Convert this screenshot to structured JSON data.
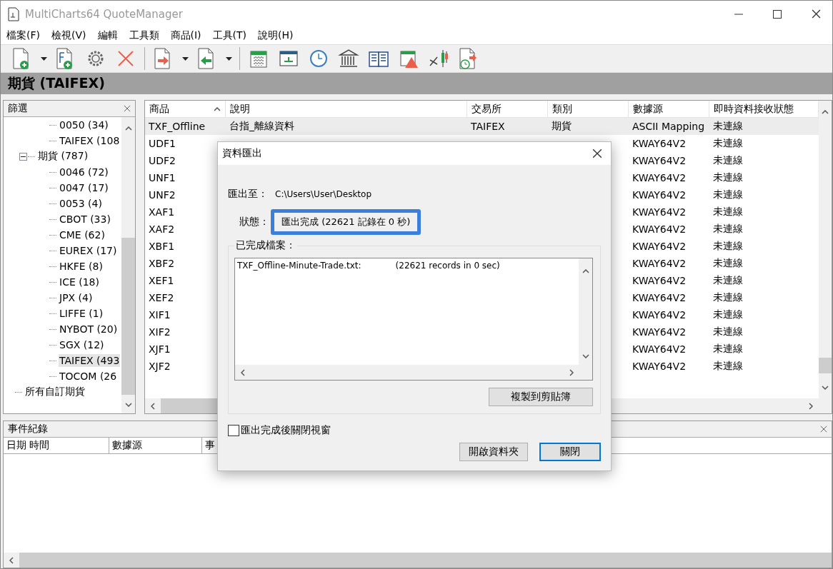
{
  "window": {
    "title": "MultiCharts64 QuoteManager"
  },
  "menu": [
    "檔案(F)",
    "檢視(V)",
    "編輯",
    "工具類",
    "商品(I)",
    "工具(T)",
    "說明(H)"
  ],
  "category_title": "期貨 (TAIFEX)",
  "filter_panel": {
    "title": "篩選",
    "tree": [
      {
        "children": [
          {
            "children": [
              {
                "label": "0050 (34)",
                "selected": false
              },
              {
                "label": "TAIFEX (108",
                "selected": false
              }
            ]
          },
          {
            "label": "期貨 (787)",
            "expanded": true,
            "selected": false,
            "children": [
              {
                "label": "0046 (72)",
                "selected": false
              },
              {
                "label": "0047 (17)",
                "selected": false
              },
              {
                "label": "0053 (4)",
                "selected": false
              },
              {
                "label": "CBOT (33)",
                "selected": false
              },
              {
                "label": "CME (62)",
                "selected": false
              },
              {
                "label": "EUREX (17)",
                "selected": false
              },
              {
                "label": "HKFE (8)",
                "selected": false
              },
              {
                "label": "ICE (18)",
                "selected": false
              },
              {
                "label": "JPX (4)",
                "selected": false
              },
              {
                "label": "LIFFE (1)",
                "selected": false
              },
              {
                "label": "NYBOT (20)",
                "selected": false
              },
              {
                "label": "SGX (12)",
                "selected": false
              },
              {
                "label": "TAIFEX (493",
                "selected": true
              },
              {
                "label": "TOCOM (26",
                "selected": false
              }
            ]
          }
        ]
      },
      {
        "label": "所有自訂期貨",
        "selected": false
      }
    ]
  },
  "symbols_table": {
    "columns": [
      {
        "label": "商品",
        "sorted": true
      },
      {
        "label": "說明",
        "sorted": false
      },
      {
        "label": "交易所",
        "sorted": false
      },
      {
        "label": "類別",
        "sorted": false
      },
      {
        "label": "數據源",
        "sorted": false
      },
      {
        "label": "即時資料接收狀態",
        "sorted": false
      }
    ],
    "rows": [
      {
        "symbol": "TXF_Offline",
        "description": "台指_離線資料",
        "exchange": "TAIFEX",
        "category": "期貨",
        "source": "ASCII Mapping",
        "status": "未連線",
        "selected": true
      },
      {
        "symbol": "UDF1",
        "source": "KWAY64V2",
        "status": "未連線",
        "selected": false
      },
      {
        "symbol": "UDF2",
        "source": "KWAY64V2",
        "status": "未連線",
        "selected": false
      },
      {
        "symbol": "UNF1",
        "source": "KWAY64V2",
        "status": "未連線",
        "selected": false
      },
      {
        "symbol": "UNF2",
        "source": "KWAY64V2",
        "status": "未連線",
        "selected": false
      },
      {
        "symbol": "XAF1",
        "source": "KWAY64V2",
        "status": "未連線",
        "selected": false
      },
      {
        "symbol": "XAF2",
        "source": "KWAY64V2",
        "status": "未連線",
        "selected": false
      },
      {
        "symbol": "XBF1",
        "source": "KWAY64V2",
        "status": "未連線",
        "selected": false
      },
      {
        "symbol": "XBF2",
        "source": "KWAY64V2",
        "status": "未連線",
        "selected": false
      },
      {
        "symbol": "XEF1",
        "source": "KWAY64V2",
        "status": "未連線",
        "selected": false
      },
      {
        "symbol": "XEF2",
        "source": "KWAY64V2",
        "status": "未連線",
        "selected": false
      },
      {
        "symbol": "XIF1",
        "source": "KWAY64V2",
        "status": "未連線",
        "selected": false
      },
      {
        "symbol": "XIF2",
        "source": "KWAY64V2",
        "status": "未連線",
        "selected": false
      },
      {
        "symbol": "XJF1",
        "source": "KWAY64V2",
        "status": "未連線",
        "selected": false
      },
      {
        "symbol": "XJF2",
        "source": "KWAY64V2",
        "status": "未連線",
        "selected": false
      }
    ]
  },
  "event_log": {
    "title": "事件紀錄",
    "columns": [
      "日期 時間",
      "數據源",
      "事"
    ]
  },
  "export_dialog": {
    "title": "資料匯出",
    "destination_label": "匯出至：",
    "destination": "C:\\Users\\User\\Desktop",
    "status_label": "狀態：",
    "status": "匯出完成 (22621 記錄在 0 秒)",
    "status_highlighted": true,
    "completed_label": "已完成檔案：",
    "files": [
      {
        "name": "TXF_Offline-Minute-Trade.txt:",
        "result": "(22621 records in 0 sec)"
      }
    ],
    "copy_button": "複製到剪貼簿",
    "close_on_finish": {
      "label": "匯出完成後關閉視窗",
      "checked": false
    },
    "buttons": [
      {
        "label": "開啟資料夾",
        "default": false
      },
      {
        "label": "關閉",
        "default": true
      }
    ]
  }
}
